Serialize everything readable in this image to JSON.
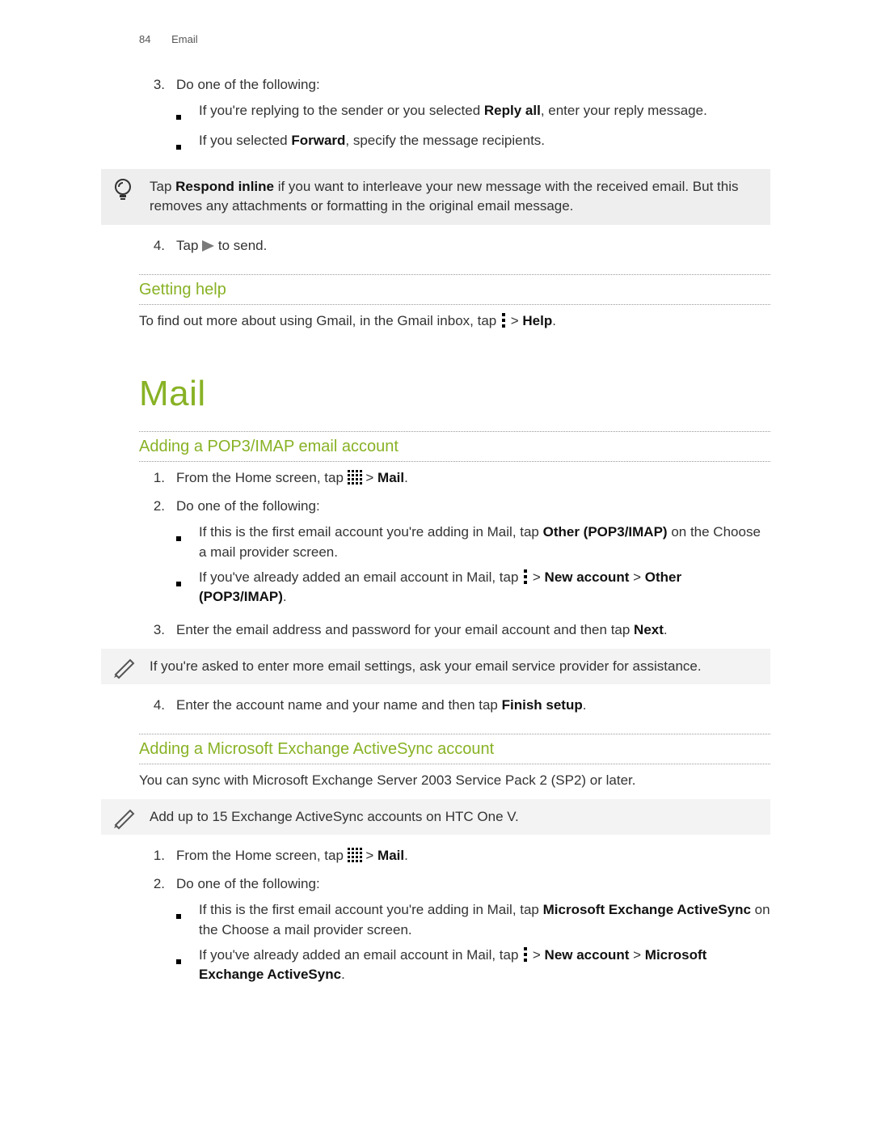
{
  "header": {
    "page_number": "84",
    "section": "Email"
  },
  "step3": {
    "num": "3.",
    "lead": "Do one of the following:",
    "bullets": [
      {
        "pre": "If you're replying to the sender or you selected ",
        "b1": "Reply all",
        "post": ", enter your reply message."
      },
      {
        "pre": "If you selected ",
        "b1": "Forward",
        "post": ", specify the message recipients."
      }
    ]
  },
  "tip1": {
    "pre": "Tap ",
    "b1": "Respond inline",
    "post": " if you want to interleave your new message with the received email. But this removes any attachments or formatting in the original email message."
  },
  "step4": {
    "num": "4.",
    "pre": "Tap ",
    "post": " to send."
  },
  "getting_help": {
    "title": "Getting help",
    "pre": "To find out more about using Gmail, in the Gmail inbox, tap ",
    "mid": " > ",
    "b1": "Help",
    "post": "."
  },
  "mail": {
    "title": "Mail"
  },
  "pop3": {
    "title": "Adding a POP3/IMAP email account",
    "s1": {
      "num": "1.",
      "pre": "From the Home screen, tap ",
      "mid": "  > ",
      "b1": "Mail",
      "post": "."
    },
    "s2": {
      "num": "2.",
      "lead": "Do one of the following:",
      "bullets": [
        {
          "pre": "If this is the first email account you're adding in Mail, tap ",
          "b1": "Other (POP3/IMAP)",
          "post": " on the Choose a mail provider screen."
        },
        {
          "pre": "If you've already added an email account in Mail, tap ",
          "mid": " > ",
          "b1": "New account",
          "mid2": " > ",
          "b2": "Other (POP3/IMAP)",
          "post": "."
        }
      ]
    },
    "s3": {
      "num": "3.",
      "pre": "Enter the email address and password for your email account and then tap ",
      "b1": "Next",
      "post": "."
    },
    "note": "If you're asked to enter more email settings, ask your email service provider for assistance.",
    "s4": {
      "num": "4.",
      "pre": "Enter the account name and your name and then tap ",
      "b1": "Finish setup",
      "post": "."
    }
  },
  "exchange": {
    "title": "Adding a Microsoft Exchange ActiveSync account",
    "intro": "You can sync with Microsoft Exchange Server 2003 Service Pack 2 (SP2) or later.",
    "note": "Add up to 15 Exchange ActiveSync accounts on HTC One V.",
    "s1": {
      "num": "1.",
      "pre": "From the Home screen, tap ",
      "mid": "  > ",
      "b1": "Mail",
      "post": "."
    },
    "s2": {
      "num": "2.",
      "lead": "Do one of the following:",
      "bullets": [
        {
          "pre": "If this is the first email account you're adding in Mail, tap ",
          "b1": "Microsoft Exchange ActiveSync",
          "post": " on the Choose a mail provider screen."
        },
        {
          "pre": "If you've already added an email account in Mail, tap ",
          "mid": " > ",
          "b1": "New account",
          "mid2": " > ",
          "b2": "Microsoft Exchange ActiveSync",
          "post": "."
        }
      ]
    }
  }
}
